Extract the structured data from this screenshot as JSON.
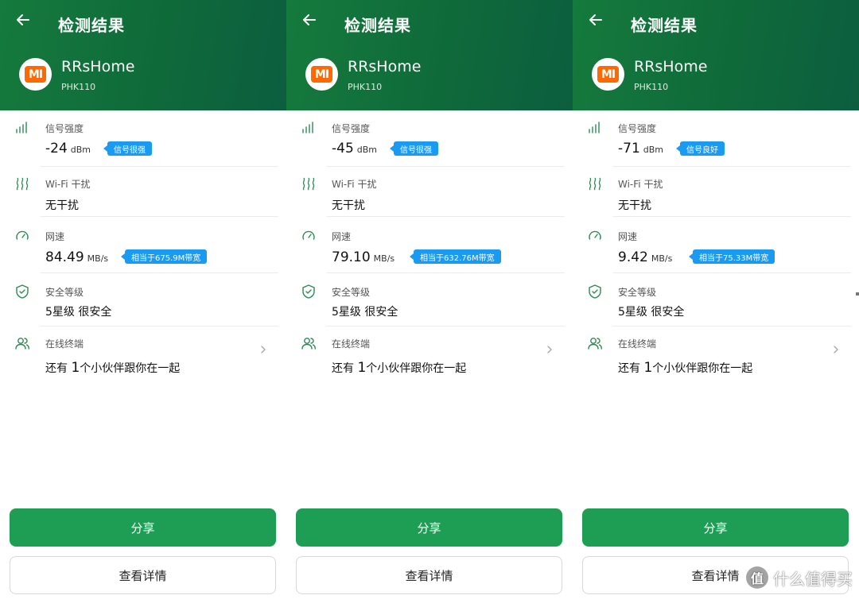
{
  "screens": [
    {
      "title": "检测结果",
      "device": {
        "name": "RRsHome",
        "model": "PHK110",
        "logo": "MI"
      },
      "signal": {
        "label": "信号强度",
        "value": "-24",
        "unit": "dBm",
        "badge": "信号很强"
      },
      "wifi": {
        "label": "Wi-Fi 干扰",
        "value": "无干扰"
      },
      "speed": {
        "label": "网速",
        "value": "84.49",
        "unit": "MB/s",
        "badge": "相当于675.9M带宽"
      },
      "security": {
        "label": "安全等级",
        "value": "5星级 很安全"
      },
      "online": {
        "label": "在线终端",
        "prefix": "还有 ",
        "count": "1",
        "suffix": "个小伙伴跟你在一起"
      },
      "share_label": "分享",
      "detail_label": "查看详情"
    },
    {
      "title": "检测结果",
      "device": {
        "name": "RRsHome",
        "model": "PHK110",
        "logo": "MI"
      },
      "signal": {
        "label": "信号强度",
        "value": "-45",
        "unit": "dBm",
        "badge": "信号很强"
      },
      "wifi": {
        "label": "Wi-Fi 干扰",
        "value": "无干扰"
      },
      "speed": {
        "label": "网速",
        "value": "79.10",
        "unit": "MB/s",
        "badge": "相当于632.76M带宽"
      },
      "security": {
        "label": "安全等级",
        "value": "5星级 很安全"
      },
      "online": {
        "label": "在线终端",
        "prefix": "还有 ",
        "count": "1",
        "suffix": "个小伙伴跟你在一起"
      },
      "share_label": "分享",
      "detail_label": "查看详情"
    },
    {
      "title": "检测结果",
      "device": {
        "name": "RRsHome",
        "model": "PHK110",
        "logo": "MI"
      },
      "signal": {
        "label": "信号强度",
        "value": "-71",
        "unit": "dBm",
        "badge": "信号良好"
      },
      "wifi": {
        "label": "Wi-Fi 干扰",
        "value": "无干扰"
      },
      "speed": {
        "label": "网速",
        "value": "9.42",
        "unit": "MB/s",
        "badge": "相当于75.33M带宽"
      },
      "security": {
        "label": "安全等级",
        "value": "5星级 很安全"
      },
      "online": {
        "label": "在线终端",
        "prefix": "还有 ",
        "count": "1",
        "suffix": "个小伙伴跟你在一起"
      },
      "share_label": "分享",
      "detail_label": "查看详情"
    }
  ],
  "icons": {
    "back": "arrow-left-icon",
    "signal": "signal-bars-icon",
    "wifi": "interference-waves-icon",
    "speed": "speedometer-icon",
    "security": "shield-check-icon",
    "online": "users-icon",
    "chevron": "chevron-right-icon"
  },
  "colors": {
    "header": "#0f6a3a",
    "accent": "#1e9e55",
    "badge": "#1b9af2",
    "logo": "#ff6a00"
  },
  "watermark": {
    "text": "什么值得买",
    "logo": "值"
  }
}
